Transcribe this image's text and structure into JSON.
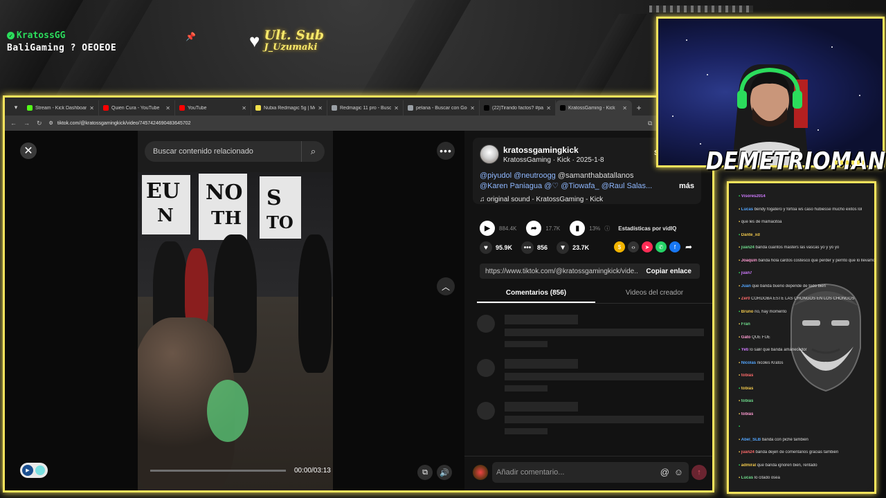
{
  "overlay": {
    "alert_user": "KratossGG",
    "alert_message": "BaliGaming ? OEOEOE",
    "last_sub_label": "Ult. Sub",
    "last_sub_name": "J_Uzumaki",
    "streamer_name": "DEMETRIOMAN"
  },
  "browser": {
    "tabs": [
      {
        "label": "Stream - Kick Dashboard",
        "color": "#53fc18"
      },
      {
        "label": "Quien Cura - YouTube",
        "color": "#ff0000"
      },
      {
        "label": "YouTube",
        "color": "#ff0000"
      },
      {
        "label": "Nubia Redmagic 5g | Mer",
        "color": "#f2e04b"
      },
      {
        "label": "Redmagic 11 pro - Busca",
        "color": "#9aa0a6"
      },
      {
        "label": "pelana - Buscar con Goo",
        "color": "#9aa0a6"
      },
      {
        "label": "(22)Tirando factos? #par",
        "color": "#000000"
      },
      {
        "label": "KratossGaming - Kick",
        "color": "#000000"
      }
    ],
    "url": "tiktok.com/@kratossgamingkick/video/7457424690483645702"
  },
  "player": {
    "search_placeholder": "Buscar contenido relacionado",
    "time": "00:00/03:13",
    "progress": 0
  },
  "post": {
    "author": "kratossgamingkick",
    "author_sub": "KratossGaming · Kick · 2025-1-8",
    "side_letter": "S",
    "mentions_line1": [
      "@piyudol",
      "@neutroogg",
      "@samanthabatallanos"
    ],
    "mentions_line2": [
      "@Karen Paniagua",
      "@♡",
      "@Tiowafa_",
      "@Raul Salas..."
    ],
    "more": "más",
    "sound": "original sound - KratossGaming - Kick",
    "plays": "884.4K",
    "shares_stat": "17.7K",
    "percent": "13%",
    "stats_label": "Estadísticas por vidIQ",
    "likes": "95.9K",
    "comments": "856",
    "saves": "23.7K",
    "link": "https://www.tiktok.com/@kratossgamingkick/vide...",
    "copy_label": "Copiar enlace",
    "tab_comments": "Comentarios (856)",
    "tab_creator": "Videos del creador",
    "comment_placeholder": "Añadir comentario..."
  },
  "chat": {
    "lines": [
      {
        "name": "Visores2014",
        "msg": ""
      },
      {
        "name": "Lucas",
        "msg": "bendy fogatero y fortoa ws caso hubiesse mucho exitos lol"
      },
      {
        "name": "",
        "msg": "que les de mamacitoa"
      },
      {
        "name": "Dante_xd",
        "msg": ""
      },
      {
        "name": "juan24",
        "msg": "banda cuantos masters las vascas yo y yo yo"
      },
      {
        "name": "Joaquin",
        "msg": "banda hola cardos costesco que perder y perrito que lo llevamos de diccionarios a la fiesta del com"
      },
      {
        "name": "juan7",
        "msg": ""
      },
      {
        "name": "Juan",
        "msg": "que banda bueno depende de todo bien"
      },
      {
        "name": "Zer0",
        "msg": "CÓRDOBA ESTE LAS CHONGOS EN LOS CHONGOS"
      },
      {
        "name": "Bruno",
        "msg": "no, hay momento"
      },
      {
        "name": "Fran",
        "msg": ""
      },
      {
        "name": "Gato",
        "msg": "QUE FUE"
      },
      {
        "name": "Yeti",
        "msg": "lo salir que banda amanecedor"
      },
      {
        "name": "Nicolas",
        "msg": "nicoles Kratos"
      },
      {
        "name": "tobias",
        "msg": ""
      },
      {
        "name": "tobias",
        "msg": ""
      },
      {
        "name": "tobias",
        "msg": ""
      },
      {
        "name": "tobias",
        "msg": ""
      },
      {
        "name": "",
        "msg": ""
      },
      {
        "name": "Abel_SLB",
        "msg": "banda con piché también"
      },
      {
        "name": "juan24",
        "msg": "banda dejen de comentarios gracias también"
      },
      {
        "name": "admiral",
        "msg": "que banda ignoren bien, rentado"
      },
      {
        "name": "Lucas",
        "msg": "lo citado osea"
      }
    ]
  },
  "colors": {
    "accent_frame": "#f6e35c",
    "kick_green": "#2bdc5c",
    "mention_blue": "#8fb8ff"
  }
}
